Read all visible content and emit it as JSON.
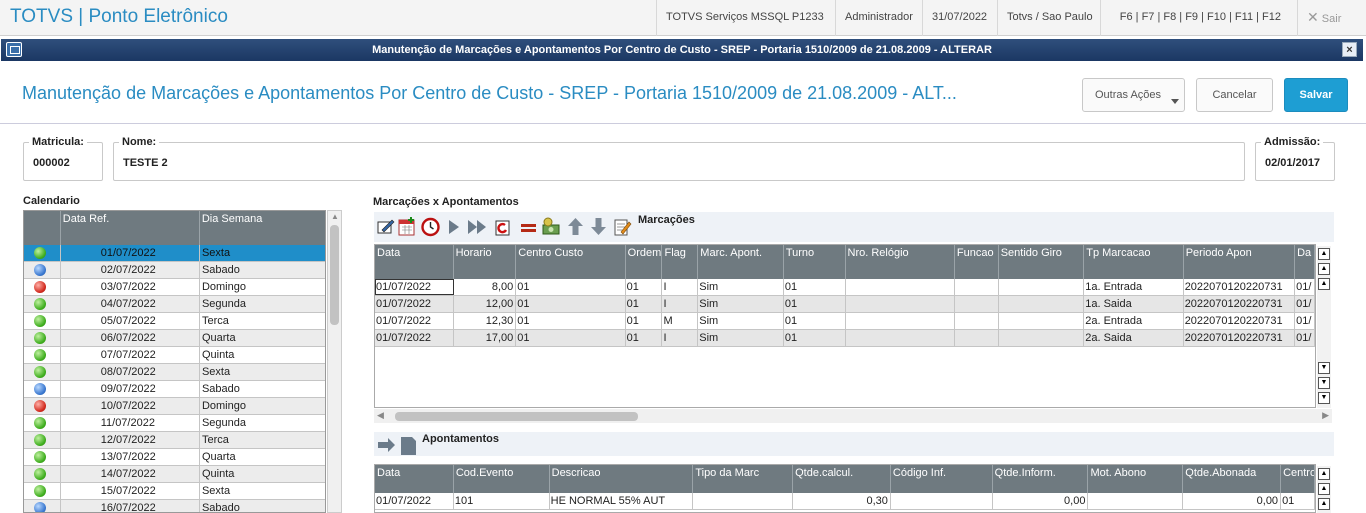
{
  "topbar": {
    "app_title": "TOTVS | Ponto Eletrônico",
    "items": [
      "TOTVS Serviços MSSQL P1233",
      "Administrador",
      "31/07/2022",
      "Totvs / Sao Paulo",
      "F6 | F7 | F8 | F9 | F10 | F11 | F12"
    ],
    "exit_label": "Sair"
  },
  "window": {
    "title": "Manutenção de Marcações e Apontamentos Por Centro de Custo - SREP - Portaria 1510/2009 de 21.08.2009 - ALTERAR",
    "close_glyph": "×"
  },
  "header": {
    "title": "Manutenção de Marcações e Apontamentos Por Centro de Custo - SREP - Portaria 1510/2009 de 21.08.2009 - ALT...",
    "other_actions": "Outras Ações",
    "cancel": "Cancelar",
    "save": "Salvar"
  },
  "fields": {
    "matricula_label": "Matricula:",
    "matricula": "000002",
    "nome_label": "Nome:",
    "nome": "TESTE 2",
    "admissao_label": "Admissão:",
    "admissao": "02/01/2017"
  },
  "calendar": {
    "title": "Calendario",
    "headers": [
      "",
      "Data Ref.",
      "Dia Semana"
    ],
    "rows": [
      {
        "status": "green",
        "date": "01/07/2022",
        "day": "Sexta"
      },
      {
        "status": "blue",
        "date": "02/07/2022",
        "day": "Sabado"
      },
      {
        "status": "red",
        "date": "03/07/2022",
        "day": "Domingo"
      },
      {
        "status": "green",
        "date": "04/07/2022",
        "day": "Segunda"
      },
      {
        "status": "green",
        "date": "05/07/2022",
        "day": "Terca"
      },
      {
        "status": "green",
        "date": "06/07/2022",
        "day": "Quarta"
      },
      {
        "status": "green",
        "date": "07/07/2022",
        "day": "Quinta"
      },
      {
        "status": "green",
        "date": "08/07/2022",
        "day": "Sexta"
      },
      {
        "status": "blue",
        "date": "09/07/2022",
        "day": "Sabado"
      },
      {
        "status": "red",
        "date": "10/07/2022",
        "day": "Domingo"
      },
      {
        "status": "green",
        "date": "11/07/2022",
        "day": "Segunda"
      },
      {
        "status": "green",
        "date": "12/07/2022",
        "day": "Terca"
      },
      {
        "status": "green",
        "date": "13/07/2022",
        "day": "Quarta"
      },
      {
        "status": "green",
        "date": "14/07/2022",
        "day": "Quinta"
      },
      {
        "status": "green",
        "date": "15/07/2022",
        "day": "Sexta"
      },
      {
        "status": "blue",
        "date": "16/07/2022",
        "day": "Sabado"
      }
    ]
  },
  "marcacoes": {
    "section_title": "Marcações x Apontamentos",
    "toolbar_label": "Marcações",
    "headers": [
      "Data",
      "Horario",
      "Centro Custo",
      "Ordem",
      "Flag",
      "Marc. Apont.",
      "Turno",
      "Nro. Relógio",
      "Funcao",
      "Sentido Giro",
      "Tp Marcacao",
      "Periodo Apon",
      "Da"
    ],
    "rows": [
      [
        "01/07/2022",
        "8,00",
        "01",
        "01",
        "I",
        "Sim",
        "01",
        "",
        "",
        "",
        "1a. Entrada",
        "2022070120220731",
        "01/"
      ],
      [
        "01/07/2022",
        "12,00",
        "01",
        "01",
        "I",
        "Sim",
        "01",
        "",
        "",
        "",
        "1a. Saida",
        "2022070120220731",
        "01/"
      ],
      [
        "01/07/2022",
        "12,30",
        "01",
        "01",
        "M",
        "Sim",
        "01",
        "",
        "",
        "",
        "2a. Entrada",
        "2022070120220731",
        "01/"
      ],
      [
        "01/07/2022",
        "17,00",
        "01",
        "01",
        "I",
        "Sim",
        "01",
        "",
        "",
        "",
        "2a. Saida",
        "2022070120220731",
        "01/"
      ]
    ]
  },
  "apontamentos": {
    "toolbar_label": "Apontamentos",
    "headers": [
      "Data",
      "Cod.Evento",
      "Descricao",
      "Tipo da Marc",
      "Qtde.calcul.",
      "Código Inf.",
      "Qtde.Inform.",
      "Mot. Abono",
      "Qtde.Abonada",
      "Centro"
    ],
    "rows": [
      [
        "01/07/2022",
        "101",
        "HE NORMAL 55% AUT",
        "",
        "0,30",
        "",
        "0,00",
        "",
        "0,00",
        "01"
      ]
    ]
  },
  "colors": {
    "accent": "#2a8cc2",
    "save": "#1e9ed3",
    "grid_header": "#6f7a80",
    "selected_row": "#1f8ec9",
    "window_bar": "#1b3763"
  }
}
